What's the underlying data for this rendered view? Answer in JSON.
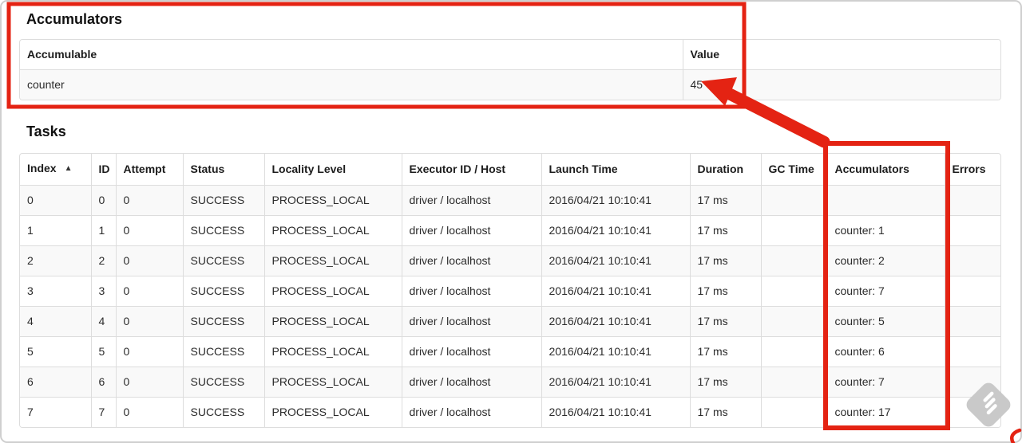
{
  "accumulators_section": {
    "title": "Accumulators",
    "table": {
      "columns": [
        {
          "label": "Accumulable"
        },
        {
          "label": "Value"
        }
      ],
      "rows": [
        [
          "counter",
          "45"
        ]
      ]
    }
  },
  "tasks_section": {
    "title": "Tasks",
    "table": {
      "columns": [
        {
          "label": "Index",
          "sort_icon": "▲"
        },
        {
          "label": "ID"
        },
        {
          "label": "Attempt"
        },
        {
          "label": "Status"
        },
        {
          "label": "Locality Level"
        },
        {
          "label": "Executor ID / Host"
        },
        {
          "label": "Launch Time"
        },
        {
          "label": "Duration"
        },
        {
          "label": "GC Time"
        },
        {
          "label": "Accumulators"
        },
        {
          "label": "Errors"
        }
      ],
      "rows": [
        [
          "0",
          "0",
          "0",
          "SUCCESS",
          "PROCESS_LOCAL",
          "driver / localhost",
          "2016/04/21 10:10:41",
          "17 ms",
          "",
          "",
          ""
        ],
        [
          "1",
          "1",
          "0",
          "SUCCESS",
          "PROCESS_LOCAL",
          "driver / localhost",
          "2016/04/21 10:10:41",
          "17 ms",
          "",
          "counter: 1",
          ""
        ],
        [
          "2",
          "2",
          "0",
          "SUCCESS",
          "PROCESS_LOCAL",
          "driver / localhost",
          "2016/04/21 10:10:41",
          "17 ms",
          "",
          "counter: 2",
          ""
        ],
        [
          "3",
          "3",
          "0",
          "SUCCESS",
          "PROCESS_LOCAL",
          "driver / localhost",
          "2016/04/21 10:10:41",
          "17 ms",
          "",
          "counter: 7",
          ""
        ],
        [
          "4",
          "4",
          "0",
          "SUCCESS",
          "PROCESS_LOCAL",
          "driver / localhost",
          "2016/04/21 10:10:41",
          "17 ms",
          "",
          "counter: 5",
          ""
        ],
        [
          "5",
          "5",
          "0",
          "SUCCESS",
          "PROCESS_LOCAL",
          "driver / localhost",
          "2016/04/21 10:10:41",
          "17 ms",
          "",
          "counter: 6",
          ""
        ],
        [
          "6",
          "6",
          "0",
          "SUCCESS",
          "PROCESS_LOCAL",
          "driver / localhost",
          "2016/04/21 10:10:41",
          "17 ms",
          "",
          "counter: 7",
          ""
        ],
        [
          "7",
          "7",
          "0",
          "SUCCESS",
          "PROCESS_LOCAL",
          "driver / localhost",
          "2016/04/21 10:10:41",
          "17 ms",
          "",
          "counter: 17",
          ""
        ]
      ]
    }
  },
  "annotations": {
    "highlight_color": "#e42313"
  },
  "watermark": {
    "color": "#c9c9c9"
  }
}
